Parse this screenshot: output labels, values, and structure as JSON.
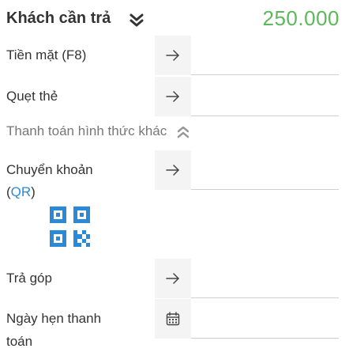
{
  "header": {
    "title": "Khách cần trả",
    "amount": "250.000",
    "chevron_icon": "double-chevron-down-icon",
    "amount_color": "#5cb85c"
  },
  "payment_methods": [
    {
      "label": "Tiền mặt (F8)",
      "button_icon": "arrow-right-icon",
      "value": ""
    },
    {
      "label": "Quẹt thẻ",
      "button_icon": "arrow-right-icon",
      "value": ""
    }
  ],
  "other_methods": {
    "toggle_label": "Thanh toán hình thức khác",
    "toggle_icon": "double-chevron-up-icon"
  },
  "transfer": {
    "label": "Chuyển khoản",
    "qr_open": "(",
    "qr_link": "QR",
    "qr_close": ")",
    "button_icon": "arrow-right-icon",
    "qr_icon": "qr-code-icon",
    "qr_color": "#2b8ad8",
    "value": ""
  },
  "installment": {
    "label": "Trả góp",
    "button_icon": "arrow-right-icon",
    "value": ""
  },
  "due_date": {
    "label_line1": "Ngày hẹn thanh",
    "label_line2": "toán",
    "button_icon": "calendar-icon",
    "value": ""
  }
}
